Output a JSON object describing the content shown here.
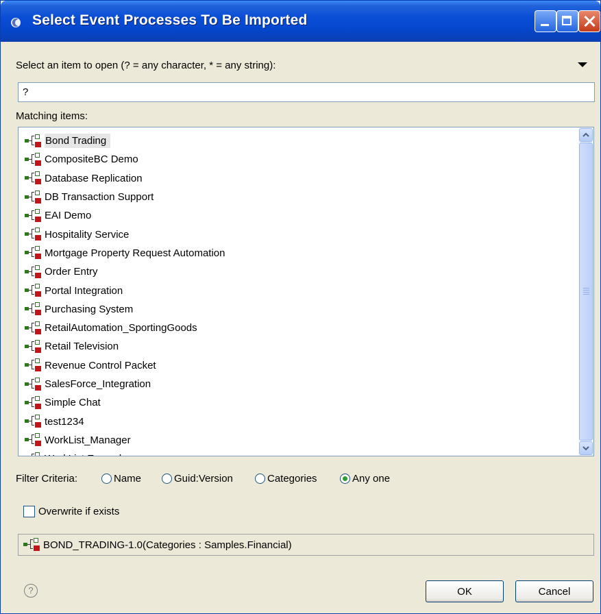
{
  "window": {
    "title": "Select Event Processes To Be Imported"
  },
  "search": {
    "prompt": "Select an item to open (? = any character, * = any string):",
    "value": "?"
  },
  "list": {
    "label": "Matching items:",
    "items": [
      {
        "label": "Bond Trading"
      },
      {
        "label": "CompositeBC Demo"
      },
      {
        "label": "Database Replication"
      },
      {
        "label": "DB Transaction Support"
      },
      {
        "label": "EAI Demo"
      },
      {
        "label": "Hospitality Service"
      },
      {
        "label": "Mortgage Property Request Automation"
      },
      {
        "label": "Order Entry"
      },
      {
        "label": "Portal Integration"
      },
      {
        "label": "Purchasing System"
      },
      {
        "label": "RetailAutomation_SportingGoods"
      },
      {
        "label": "Retail Television"
      },
      {
        "label": "Revenue Control Packet"
      },
      {
        "label": "SalesForce_Integration"
      },
      {
        "label": "Simple Chat"
      },
      {
        "label": "test1234"
      },
      {
        "label": "WorkList_Manager"
      },
      {
        "label": "WorkList Example"
      }
    ],
    "selected": "Bond Trading"
  },
  "filter": {
    "label": "Filter Criteria:",
    "options": [
      {
        "label": "Name",
        "checked": false
      },
      {
        "label": "Guid:Version",
        "checked": false
      },
      {
        "label": "Categories",
        "checked": false
      },
      {
        "label": "Any one",
        "checked": true
      }
    ]
  },
  "overwrite": {
    "label": "Overwrite if exists",
    "checked": false
  },
  "status": {
    "text": "BOND_TRADING-1.0(Categories : Samples.Financial)"
  },
  "buttons": {
    "help": "?",
    "ok": "OK",
    "cancel": "Cancel"
  },
  "colors": {
    "titlebar": "#0a4ed6",
    "dialog_bg": "#ece9d8",
    "selection": "#e6e6e6",
    "radio_dot": "#2f9a2f"
  }
}
